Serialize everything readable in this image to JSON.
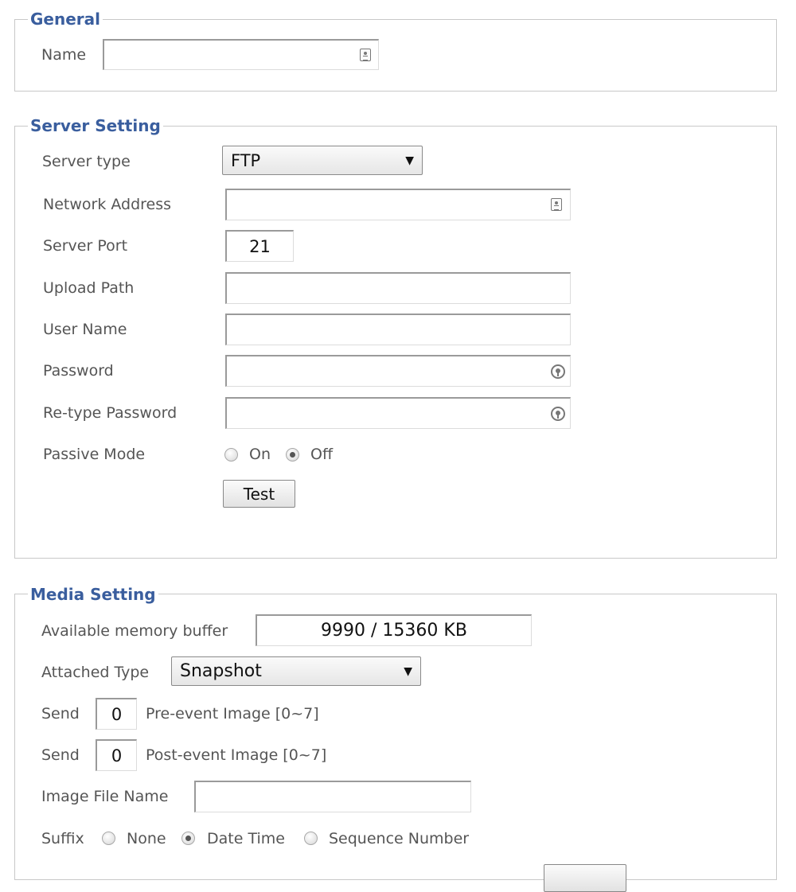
{
  "general": {
    "legend": "General",
    "name_label": "Name",
    "name_value": "",
    "name_icon": "contact-card-icon"
  },
  "server": {
    "legend": "Server Setting",
    "server_type_label": "Server type",
    "server_type_value": "FTP",
    "network_address_label": "Network Address",
    "network_address_value": "",
    "network_address_icon": "contact-card-icon",
    "server_port_label": "Server Port",
    "server_port_value": "21",
    "upload_path_label": "Upload Path",
    "upload_path_value": "",
    "user_name_label": "User Name",
    "user_name_value": "",
    "password_label": "Password",
    "password_value": "",
    "password_icon": "key-icon",
    "retype_password_label": "Re-type Password",
    "retype_password_value": "",
    "passive_mode_label": "Passive Mode",
    "passive_on_label": "On",
    "passive_off_label": "Off",
    "passive_selected": "Off",
    "test_button_label": "Test"
  },
  "media": {
    "legend": "Media Setting",
    "memory_buffer_label": "Available memory buffer",
    "memory_buffer_value": "9990 / 15360 KB",
    "attached_type_label": "Attached Type",
    "attached_type_value": "Snapshot",
    "send_label": "Send",
    "pre_event_value": "0",
    "pre_event_label": "Pre-event Image [0~7]",
    "post_event_value": "0",
    "post_event_label": "Post-event Image [0~7]",
    "image_file_name_label": "Image File Name",
    "image_file_name_value": "",
    "suffix_label": "Suffix",
    "suffix_none_label": "None",
    "suffix_datetime_label": "Date Time",
    "suffix_sequence_label": "Sequence Number",
    "suffix_selected": "Date Time"
  },
  "colors": {
    "legend": "#3a5e9e",
    "label": "#555555",
    "frame_border": "#c8c8c8"
  }
}
